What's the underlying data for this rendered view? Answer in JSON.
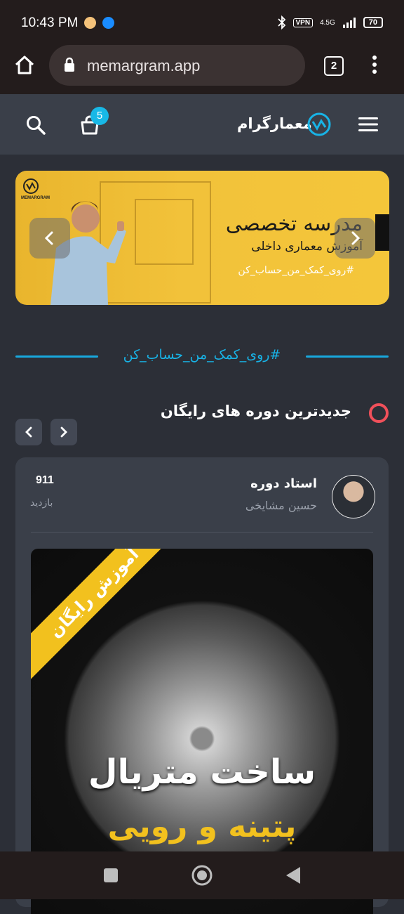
{
  "status_bar": {
    "time": "10:43 PM",
    "vpn": "VPN",
    "network": "4.5G",
    "battery": "70"
  },
  "browser": {
    "url": "memargram.app",
    "tab_count": "2"
  },
  "site_header": {
    "logo_text": "معمارگرام",
    "cart_count": "5"
  },
  "banner": {
    "logo_caption": "MEMARGRAM",
    "title": "مدرسه تخصصی",
    "subtitle": "آموزش معماری داخلی",
    "hashtag": "#روی_کمک_من_حساب_کن"
  },
  "hashtag_divider": "#روی_کمک_من_حساب_کن",
  "section": {
    "title": "جدیدترین دوره های رایگان"
  },
  "course_card": {
    "role": "استاد دوره",
    "teacher": "حسین مشایخی",
    "views": "911",
    "views_label": "بازدید",
    "ribbon": "آموزش رایگان",
    "poster_title": "ساخت متریال",
    "poster_subtitle": "پتینه و رویی"
  },
  "colors": {
    "accent": "#18b3e6",
    "banner_yellow": "#f2c23a",
    "section_dot": "#f0505a"
  }
}
